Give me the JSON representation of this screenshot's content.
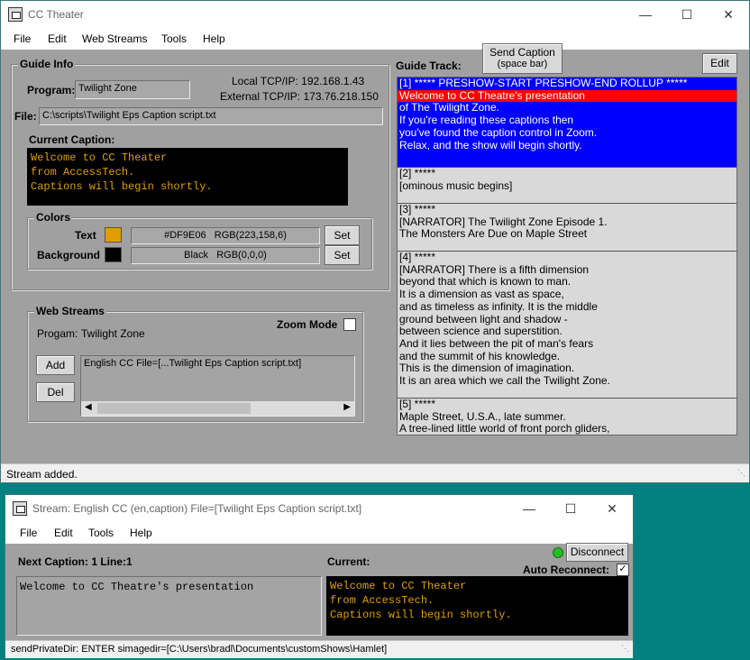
{
  "main": {
    "title": "CC Theater",
    "menu": [
      "File",
      "Edit",
      "Web Streams",
      "Tools",
      "Help"
    ],
    "guide_info": {
      "label": "Guide Info",
      "program_label": "Program:",
      "program_value": "Twilight Zone",
      "local_ip": "Local TCP/IP: 192.168.1.43",
      "external_ip": "External TCP/IP: 173.76.218.150",
      "file_label": "File:",
      "file_value": "C:\\scripts\\Twilight Eps Caption script.txt",
      "current_caption_label": "Current Caption:",
      "current_caption_lines": [
        "Welcome to CC Theater",
        "from AccessTech.",
        "Captions will begin shortly."
      ]
    },
    "colors": {
      "label": "Colors",
      "text_label": "Text",
      "text_color": "#DF9E06",
      "text_hex": "#DF9E06",
      "text_rgb": "RGB(223,158,6)",
      "background_label": "Background",
      "background_color": "#000000",
      "background_name": "Black",
      "background_rgb": "RGB(0,0,0)",
      "set_label": "Set"
    },
    "web_streams": {
      "label": "Web Streams",
      "program_label": "Progam:",
      "program_value": "Twilight Zone",
      "zoom_mode_label": "Zoom Mode",
      "zoom_mode_checked": false,
      "add_label": "Add",
      "del_label": "Del",
      "list": [
        "English CC File=[...Twilight Eps Caption script.txt]"
      ]
    },
    "send_caption": {
      "line1": "Send Caption",
      "line2": "(space bar)"
    },
    "guide_track": {
      "label": "Guide Track:",
      "edit_label": "Edit",
      "entries": [
        {
          "header": "[1]  ***** PRESHOW-START  PRESHOW-END  ROLLUP *****",
          "highlight": "Welcome to CC Theatre's presentation",
          "lines": [
            "of The Twilight Zone.",
            "If you're reading these captions then",
            "you've found the caption control in Zoom.",
            "Relax, and the show will begin shortly."
          ]
        },
        {
          "header": "[2]  *****",
          "lines": [
            "[ominous music begins]"
          ]
        },
        {
          "header": "[3]  *****",
          "lines": [
            "[NARRATOR] The Twilight Zone Episode 1.",
            "The Monsters Are Due on Maple Street"
          ]
        },
        {
          "header": "[4]  *****",
          "lines": [
            "[NARRATOR] There is a fifth dimension",
            "beyond that which is known to man.",
            "It is a dimension as vast as space,",
            "and as timeless as infinity. It is the middle",
            "ground between light and shadow -",
            "between science and superstition.",
            "And it lies between the pit of man's fears",
            "and the summit of his knowledge.",
            "This is the dimension of imagination.",
            "It is an area which we call the Twilight Zone."
          ]
        },
        {
          "header": "[5]  *****",
          "lines": [
            "Maple Street, U.S.A., late summer.",
            "A tree-lined little world of front porch gliders,"
          ]
        }
      ]
    },
    "status": "Stream added."
  },
  "stream": {
    "title": "Stream: English CC (en,caption)   File=[Twilight Eps Caption script.txt]",
    "menu": [
      "File",
      "Edit",
      "Tools",
      "Help"
    ],
    "next_caption_label": "Next Caption: 1  Line:1",
    "next_caption_text": "Welcome to CC Theatre's presentation",
    "current_label": "Current:",
    "disconnect_label": "Disconnect",
    "connected_color": "#22c022",
    "auto_reconnect_label": "Auto Reconnect:",
    "auto_reconnect_checked": true,
    "current_lines": [
      "Welcome to CC Theater",
      "from AccessTech.",
      "Captions will begin shortly."
    ],
    "status": "sendPrivateDir: ENTER simagedir=[C:\\Users\\bradl\\Documents\\customShows\\Hamlet]"
  }
}
